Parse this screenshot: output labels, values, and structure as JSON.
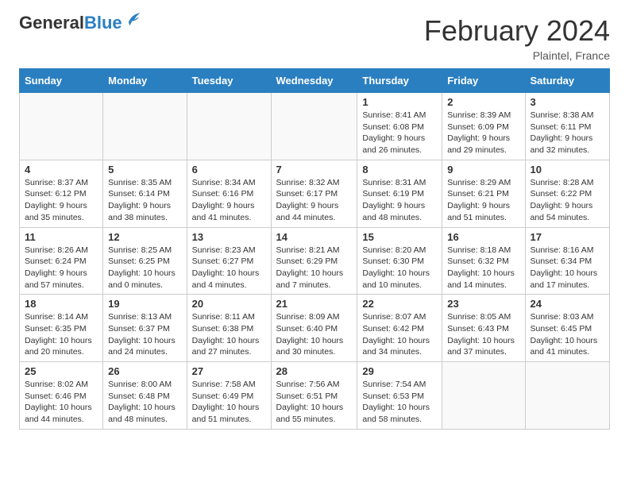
{
  "header": {
    "logo_general": "General",
    "logo_blue": "Blue",
    "month_year": "February 2024",
    "location": "Plaintel, France"
  },
  "days_of_week": [
    "Sunday",
    "Monday",
    "Tuesday",
    "Wednesday",
    "Thursday",
    "Friday",
    "Saturday"
  ],
  "weeks": [
    [
      {
        "day": "",
        "info": ""
      },
      {
        "day": "",
        "info": ""
      },
      {
        "day": "",
        "info": ""
      },
      {
        "day": "",
        "info": ""
      },
      {
        "day": "1",
        "info": "Sunrise: 8:41 AM\nSunset: 6:08 PM\nDaylight: 9 hours and 26 minutes."
      },
      {
        "day": "2",
        "info": "Sunrise: 8:39 AM\nSunset: 6:09 PM\nDaylight: 9 hours and 29 minutes."
      },
      {
        "day": "3",
        "info": "Sunrise: 8:38 AM\nSunset: 6:11 PM\nDaylight: 9 hours and 32 minutes."
      }
    ],
    [
      {
        "day": "4",
        "info": "Sunrise: 8:37 AM\nSunset: 6:12 PM\nDaylight: 9 hours and 35 minutes."
      },
      {
        "day": "5",
        "info": "Sunrise: 8:35 AM\nSunset: 6:14 PM\nDaylight: 9 hours and 38 minutes."
      },
      {
        "day": "6",
        "info": "Sunrise: 8:34 AM\nSunset: 6:16 PM\nDaylight: 9 hours and 41 minutes."
      },
      {
        "day": "7",
        "info": "Sunrise: 8:32 AM\nSunset: 6:17 PM\nDaylight: 9 hours and 44 minutes."
      },
      {
        "day": "8",
        "info": "Sunrise: 8:31 AM\nSunset: 6:19 PM\nDaylight: 9 hours and 48 minutes."
      },
      {
        "day": "9",
        "info": "Sunrise: 8:29 AM\nSunset: 6:21 PM\nDaylight: 9 hours and 51 minutes."
      },
      {
        "day": "10",
        "info": "Sunrise: 8:28 AM\nSunset: 6:22 PM\nDaylight: 9 hours and 54 minutes."
      }
    ],
    [
      {
        "day": "11",
        "info": "Sunrise: 8:26 AM\nSunset: 6:24 PM\nDaylight: 9 hours and 57 minutes."
      },
      {
        "day": "12",
        "info": "Sunrise: 8:25 AM\nSunset: 6:25 PM\nDaylight: 10 hours and 0 minutes."
      },
      {
        "day": "13",
        "info": "Sunrise: 8:23 AM\nSunset: 6:27 PM\nDaylight: 10 hours and 4 minutes."
      },
      {
        "day": "14",
        "info": "Sunrise: 8:21 AM\nSunset: 6:29 PM\nDaylight: 10 hours and 7 minutes."
      },
      {
        "day": "15",
        "info": "Sunrise: 8:20 AM\nSunset: 6:30 PM\nDaylight: 10 hours and 10 minutes."
      },
      {
        "day": "16",
        "info": "Sunrise: 8:18 AM\nSunset: 6:32 PM\nDaylight: 10 hours and 14 minutes."
      },
      {
        "day": "17",
        "info": "Sunrise: 8:16 AM\nSunset: 6:34 PM\nDaylight: 10 hours and 17 minutes."
      }
    ],
    [
      {
        "day": "18",
        "info": "Sunrise: 8:14 AM\nSunset: 6:35 PM\nDaylight: 10 hours and 20 minutes."
      },
      {
        "day": "19",
        "info": "Sunrise: 8:13 AM\nSunset: 6:37 PM\nDaylight: 10 hours and 24 minutes."
      },
      {
        "day": "20",
        "info": "Sunrise: 8:11 AM\nSunset: 6:38 PM\nDaylight: 10 hours and 27 minutes."
      },
      {
        "day": "21",
        "info": "Sunrise: 8:09 AM\nSunset: 6:40 PM\nDaylight: 10 hours and 30 minutes."
      },
      {
        "day": "22",
        "info": "Sunrise: 8:07 AM\nSunset: 6:42 PM\nDaylight: 10 hours and 34 minutes."
      },
      {
        "day": "23",
        "info": "Sunrise: 8:05 AM\nSunset: 6:43 PM\nDaylight: 10 hours and 37 minutes."
      },
      {
        "day": "24",
        "info": "Sunrise: 8:03 AM\nSunset: 6:45 PM\nDaylight: 10 hours and 41 minutes."
      }
    ],
    [
      {
        "day": "25",
        "info": "Sunrise: 8:02 AM\nSunset: 6:46 PM\nDaylight: 10 hours and 44 minutes."
      },
      {
        "day": "26",
        "info": "Sunrise: 8:00 AM\nSunset: 6:48 PM\nDaylight: 10 hours and 48 minutes."
      },
      {
        "day": "27",
        "info": "Sunrise: 7:58 AM\nSunset: 6:49 PM\nDaylight: 10 hours and 51 minutes."
      },
      {
        "day": "28",
        "info": "Sunrise: 7:56 AM\nSunset: 6:51 PM\nDaylight: 10 hours and 55 minutes."
      },
      {
        "day": "29",
        "info": "Sunrise: 7:54 AM\nSunset: 6:53 PM\nDaylight: 10 hours and 58 minutes."
      },
      {
        "day": "",
        "info": ""
      },
      {
        "day": "",
        "info": ""
      }
    ]
  ]
}
